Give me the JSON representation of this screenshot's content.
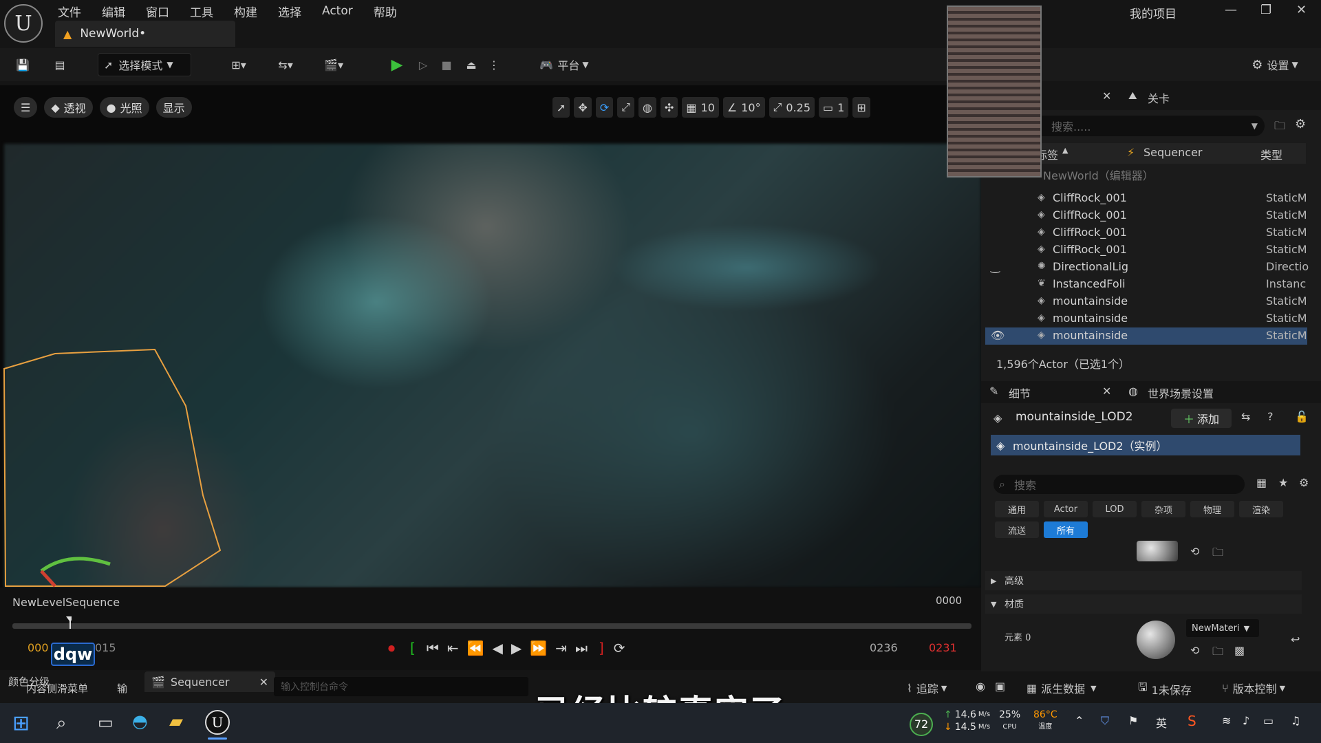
{
  "app": {
    "menu": [
      "文件",
      "编辑",
      "窗口",
      "工具",
      "构建",
      "选择",
      "Actor",
      "帮助"
    ],
    "document_tab": "NewWorld•",
    "project_name": "我的项目"
  },
  "toolbar": {
    "mode_label": "选择模式",
    "platform_label": "平台",
    "settings_label": "设置"
  },
  "viewport": {
    "perspective": "透视",
    "lighting": "光照",
    "show": "显示",
    "grid_snap": "10",
    "rotate_snap": "10°",
    "scale_snap": "0.25",
    "camera_speed": "1"
  },
  "outliner": {
    "level_tab": "关卡",
    "search_placeholder": "搜索.....",
    "col_label": "标签",
    "col_sequencer": "Sequencer",
    "col_type": "类型",
    "world_row": "NewWorld（编辑器）",
    "rows": [
      {
        "name": "CliffRock_001",
        "type": "StaticM",
        "icon": "static-mesh-icon"
      },
      {
        "name": "CliffRock_001",
        "type": "StaticM",
        "icon": "static-mesh-icon"
      },
      {
        "name": "CliffRock_001",
        "type": "StaticM",
        "icon": "static-mesh-icon"
      },
      {
        "name": "CliffRock_001",
        "type": "StaticM",
        "icon": "static-mesh-icon"
      },
      {
        "name": "DirectionalLig",
        "type": "Directio",
        "icon": "light-icon"
      },
      {
        "name": "InstancedFoli",
        "type": "Instanc",
        "icon": "foliage-icon"
      },
      {
        "name": "mountainside",
        "type": "StaticM",
        "icon": "static-mesh-icon"
      },
      {
        "name": "mountainside",
        "type": "StaticM",
        "icon": "static-mesh-icon"
      },
      {
        "name": "mountainside",
        "type": "StaticM",
        "icon": "static-mesh-icon",
        "selected": true
      }
    ],
    "actor_count": "1,596个Actor（已选1个）"
  },
  "details": {
    "tab_details": "细节",
    "tab_world": "世界场景设置",
    "object_name": "mountainside_LOD2",
    "add_label": "添加",
    "instance_row": "mountainside_LOD2（实例）",
    "search_placeholder": "搜索",
    "filter_tabs": [
      "通用",
      "Actor",
      "LOD",
      "杂项",
      "物理",
      "渲染",
      "流送",
      "所有"
    ],
    "section_advanced": "高级",
    "section_material": "材质",
    "element_label": "元素 0",
    "material_name": "NewMateri"
  },
  "sequencer": {
    "sequence_name": "NewLevelSequence",
    "current_frame": "0000",
    "start_frame": "000",
    "marker_frame": "015",
    "end_frame": "0236",
    "end_red": "0231",
    "tab_label": "Sequencer"
  },
  "bottom": {
    "content_drawer": "内容侧滑菜单",
    "output_log": "输",
    "console_placeholder": "输入控制台命令",
    "trace": "追踪",
    "derived_data": "派生数据",
    "unsaved": "1未保存",
    "version_control": "版本控制",
    "color_grading": "颜色分级"
  },
  "overlay": {
    "subtitle": "已经比较真实了",
    "badge": "dqw"
  },
  "taskbar": {
    "badge_number": "72",
    "upload": "14.6",
    "download": "14.5",
    "speed_unit": "M/s",
    "cpu_percent": "25%",
    "cpu_label": "CPU",
    "temperature": "86°C",
    "temp_label": "温度",
    "ime": "英"
  }
}
